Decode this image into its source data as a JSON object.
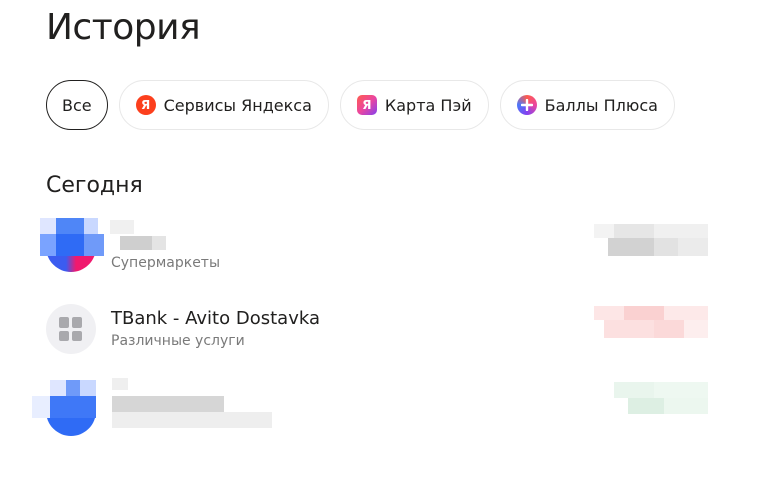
{
  "page": {
    "title": "История"
  },
  "filters": [
    {
      "label": "Все",
      "icon": null,
      "active": true
    },
    {
      "label": "Сервисы Яндекса",
      "icon": "yandex-icon",
      "icon_glyph": "Я"
    },
    {
      "label": "Карта Пэй",
      "icon": "yandex-pay-card-icon",
      "icon_glyph": "Я"
    },
    {
      "label": "Баллы Плюса",
      "icon": "plus-points-icon",
      "icon_glyph": ""
    }
  ],
  "section": {
    "title": "Сегодня"
  },
  "transactions": [
    {
      "name": "",
      "category": "Супермаркеты",
      "avatar_icon": "merchant-logo-icon",
      "amount_color": "#d0d0d0",
      "redacted": true
    },
    {
      "name": "TBank - Avito Dostavka",
      "category": "Различные услуги",
      "avatar_icon": "services-grid-icon",
      "amount_color": "#f9d4d4",
      "redacted": false
    },
    {
      "name": "",
      "category": "",
      "avatar_icon": "merchant-logo-icon",
      "amount_color": "#d6ecdc",
      "redacted": true
    }
  ],
  "colors": {
    "accent_red": "#fc3f1d",
    "text_primary": "#21201f",
    "text_secondary": "#7a7a7a",
    "chip_border": "#e8e8e8"
  }
}
